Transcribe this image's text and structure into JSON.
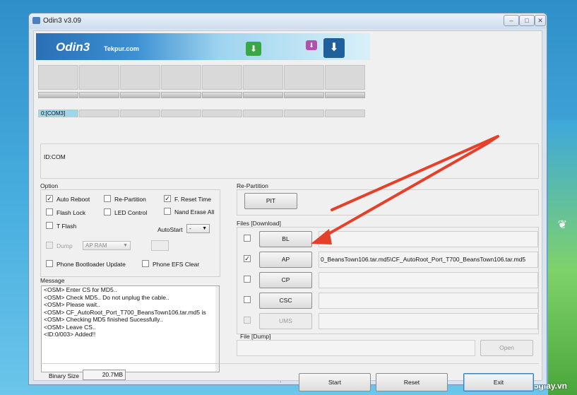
{
  "window": {
    "title": "Odin3 v3.09",
    "min_label": "–",
    "max_label": "□",
    "close_label": "✕"
  },
  "banner": {
    "logo": "Odin3",
    "subtitle": "Tekpur.com",
    "icon1": "download-green-icon",
    "icon2": "download-purple-icon",
    "icon3": "download-blue-icon"
  },
  "ports": [
    {
      "id": "0:[COM3]"
    },
    {
      "id": ""
    },
    {
      "id": ""
    },
    {
      "id": ""
    },
    {
      "id": ""
    },
    {
      "id": ""
    },
    {
      "id": ""
    },
    {
      "id": ""
    }
  ],
  "idcom": {
    "label": "ID:COM"
  },
  "option": {
    "title": "Option",
    "auto_reboot": "Auto Reboot",
    "re_partition": "Re-Partition",
    "f_reset_time": "F. Reset Time",
    "flash_lock": "Flash Lock",
    "led_control": "LED Control",
    "nand_erase_all": "Nand Erase All",
    "t_flash": "T Flash",
    "autostart_label": "AutoStart",
    "autostart_value": "-",
    "dump": "Dump",
    "dump_combo": "AP RAM",
    "phone_bootloader_update": "Phone Bootloader Update",
    "phone_efs_clear": "Phone EFS Clear",
    "checked": [
      "auto_reboot",
      "f_reset_time"
    ]
  },
  "message": {
    "title": "Message",
    "lines": [
      "<OSM> Enter CS for MD5..",
      "<OSM> Check MD5.. Do not unplug the cable..",
      "<OSM> Please wait..",
      "<OSM> CF_AutoRoot_Port_T700_BeansTown106.tar.md5 is",
      "<OSM> Checking MD5 finished Sucessfully..",
      "<OSM> Leave CS..",
      "<ID:0/003> Added!!"
    ]
  },
  "repartition": {
    "title": "Re-Partition",
    "pit": "PIT"
  },
  "files": {
    "title": "Files [Download]",
    "bl": "BL",
    "ap": "AP",
    "cp": "CP",
    "csc": "CSC",
    "ums": "UMS",
    "ap_path": "0_BeansTown106.tar.md5\\CF_AutoRoot_Port_T700_BeansTown106.tar.md5",
    "ap_checked": true
  },
  "file_dump": {
    "title": "File [Dump]",
    "open": "Open"
  },
  "bottom": {
    "binary_size_label": "Binary Size",
    "binary_size_value": "20.7MB",
    "dot": ".",
    "start": "Start",
    "reset": "Reset",
    "exit": "Exit"
  },
  "watermark": "5giay.vn",
  "colors": {
    "arrow": "#e5402a",
    "active_port": "#9fd6e8"
  }
}
